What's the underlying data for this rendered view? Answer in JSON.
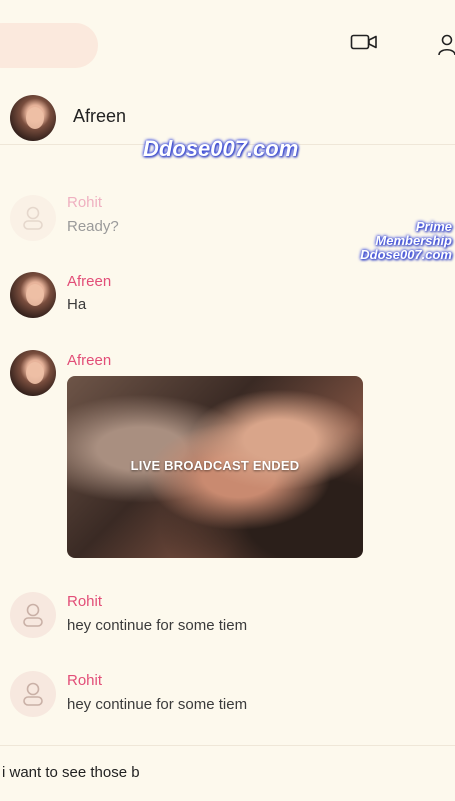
{
  "top_bar": {
    "icons": [
      "video-call-icon",
      "group-icon"
    ]
  },
  "chat_header": {
    "contact_name": "Afreen"
  },
  "watermark": {
    "main": "Ddose007.com",
    "side_line1": "Prime",
    "side_line2": "Membership",
    "side_line3": "Ddose007.com"
  },
  "messages": [
    {
      "sender": "Rohit",
      "text": "Ready?",
      "faded": true
    },
    {
      "sender": "Afreen",
      "text": "Ha"
    },
    {
      "sender": "Afreen",
      "attachment_label": "LIVE BROADCAST ENDED"
    },
    {
      "sender": "Rohit",
      "text": "hey continue for some tiem"
    },
    {
      "sender": "Rohit",
      "text": "hey continue for some tiem"
    }
  ],
  "composer": {
    "value": "i want to see those b"
  },
  "colors": {
    "background": "#fdf9ed",
    "sender_name": "#e24e78",
    "placeholder_avatar": "#f7e8df"
  }
}
